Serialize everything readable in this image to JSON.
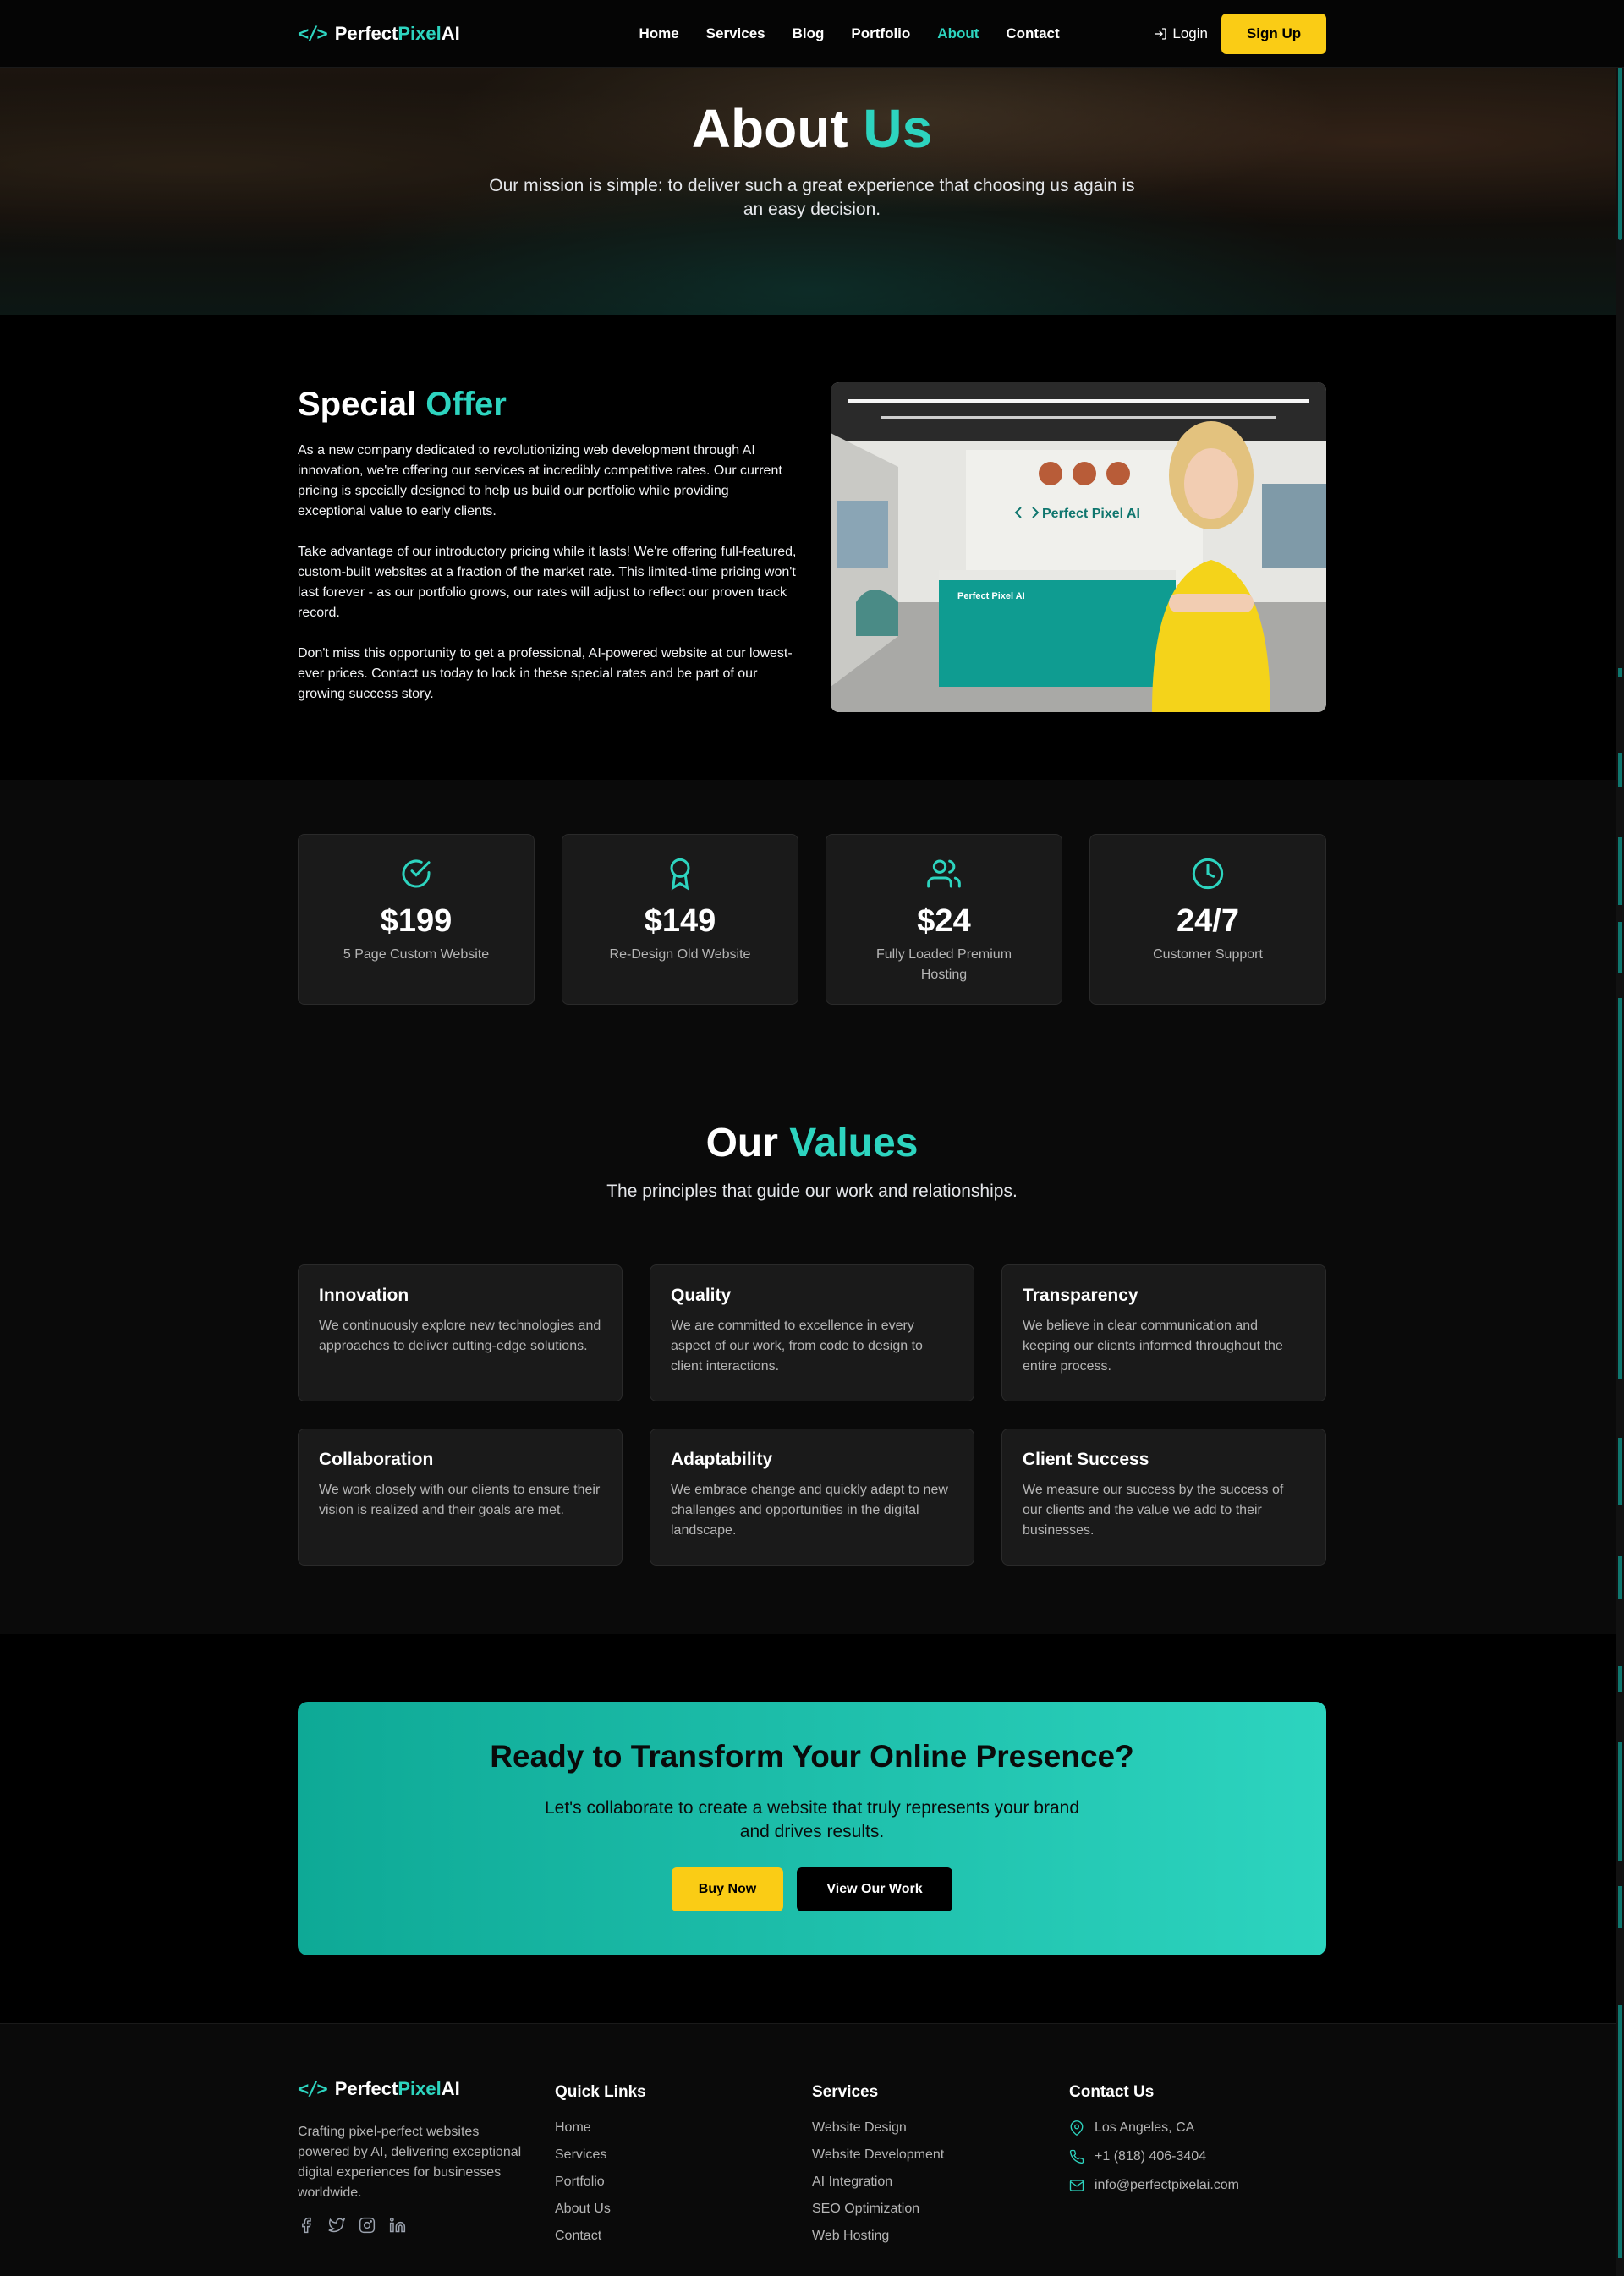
{
  "brand": {
    "name_part1": "Perfect",
    "name_part2": "Pixel",
    "name_part3": "AI"
  },
  "nav": {
    "links": [
      "Home",
      "Services",
      "Blog",
      "Portfolio",
      "About",
      "Contact"
    ],
    "active": "About",
    "login_label": "Login",
    "signup_label": "Sign Up"
  },
  "hero": {
    "title_part1": "About",
    "title_part2": "Us",
    "subtitle": "Our mission is simple: to deliver such a great experience that choosing us again is an easy decision."
  },
  "offer": {
    "title_part1": "Special",
    "title_part2": "Offer",
    "paragraphs": [
      "As a new company dedicated to revolutionizing web development through AI innovation, we're offering our services at incredibly competitive rates. Our current pricing is specially designed to help us build our portfolio while providing exceptional value to early clients.",
      "Take advantage of our introductory pricing while it lasts! We're offering full-featured, custom-built websites at a fraction of the market rate. This limited-time pricing won't last forever - as our portfolio grows, our rates will adjust to reflect our proven track record.",
      "Don't miss this opportunity to get a professional, AI-powered website at our lowest-ever prices. Contact us today to lock in these special rates and be part of our growing success story."
    ],
    "image_sign_wall": "Perfect Pixel AI",
    "image_sign_desk": "Perfect Pixel AI"
  },
  "stats": [
    {
      "icon": "check-circle-icon",
      "value": "$199",
      "label": "5 Page Custom Website"
    },
    {
      "icon": "award-icon",
      "value": "$149",
      "label": "Re-Design Old Website"
    },
    {
      "icon": "users-icon",
      "value": "$24",
      "label": "Fully Loaded Premium Hosting"
    },
    {
      "icon": "clock-icon",
      "value": "24/7",
      "label": "Customer Support"
    }
  ],
  "values": {
    "title_part1": "Our",
    "title_part2": "Values",
    "subtitle": "The principles that guide our work and relationships.",
    "cards": [
      {
        "title": "Innovation",
        "text": "We continuously explore new technologies and approaches to deliver cutting-edge solutions."
      },
      {
        "title": "Quality",
        "text": "We are committed to excellence in every aspect of our work, from code to design to client interactions."
      },
      {
        "title": "Transparency",
        "text": "We believe in clear communication and keeping our clients informed throughout the entire process."
      },
      {
        "title": "Collaboration",
        "text": "We work closely with our clients to ensure their vision is realized and their goals are met."
      },
      {
        "title": "Adaptability",
        "text": "We embrace change and quickly adapt to new challenges and opportunities in the digital landscape."
      },
      {
        "title": "Client Success",
        "text": "We measure our success by the success of our clients and the value we add to their businesses."
      }
    ]
  },
  "cta": {
    "title": "Ready to Transform Your Online Presence?",
    "subtitle": "Let's collaborate to create a website that truly represents your brand and drives results.",
    "primary_label": "Buy Now",
    "secondary_label": "View Our Work"
  },
  "footer": {
    "description": "Crafting pixel-perfect websites powered by AI, delivering exceptional digital experiences for businesses worldwide.",
    "quick_links_title": "Quick Links",
    "quick_links": [
      "Home",
      "Services",
      "Portfolio",
      "About Us",
      "Contact"
    ],
    "services_title": "Services",
    "services": [
      "Website Design",
      "Website Development",
      "AI Integration",
      "SEO Optimization",
      "Web Hosting"
    ],
    "contact_title": "Contact Us",
    "location": "Los Angeles, CA",
    "phone": "+1 (818) 406-3404",
    "email": "info@perfectpixelai.com",
    "social_icons": [
      "facebook-icon",
      "twitter-icon",
      "instagram-icon",
      "linkedin-icon"
    ]
  },
  "colors": {
    "accent": "#2dd4bf",
    "button": "#facc15",
    "background": "#000000",
    "card": "#1a1a1a"
  }
}
